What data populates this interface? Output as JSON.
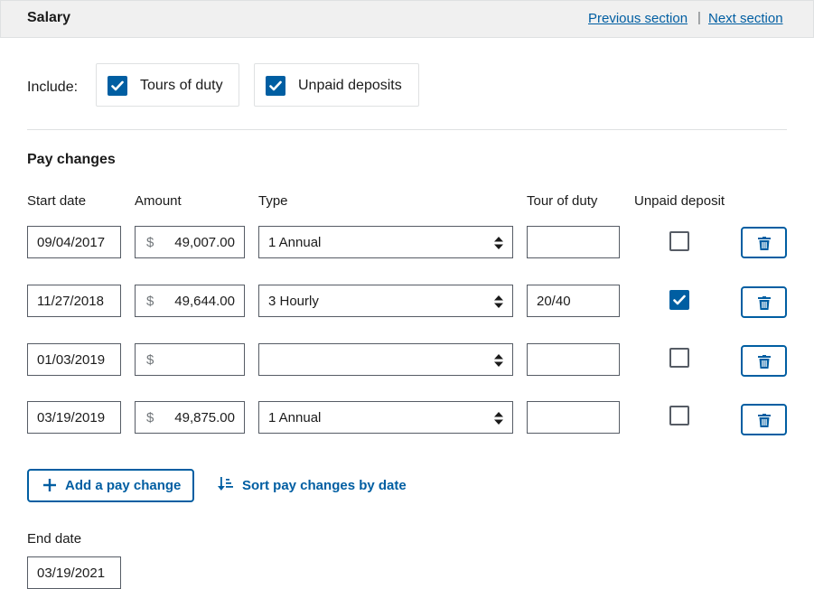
{
  "header": {
    "title": "Salary",
    "prev_link": "Previous section",
    "separator": "|",
    "next_link": "Next section"
  },
  "include": {
    "label": "Include:",
    "options": [
      {
        "label": "Tours of duty",
        "checked": true
      },
      {
        "label": "Unpaid deposits",
        "checked": true
      }
    ]
  },
  "pay_changes": {
    "title": "Pay changes",
    "columns": [
      "Start date",
      "Amount",
      "Type",
      "Tour of duty",
      "Unpaid deposit"
    ],
    "currency_symbol": "$",
    "rows": [
      {
        "start_date": "09/04/2017",
        "amount": "49,007.00",
        "type": "1  Annual",
        "tour": "",
        "unpaid": false
      },
      {
        "start_date": "11/27/2018",
        "amount": "49,644.00",
        "type": "3  Hourly",
        "tour": "20/40",
        "unpaid": true
      },
      {
        "start_date": "01/03/2019",
        "amount": "",
        "type": "",
        "tour": "",
        "unpaid": false
      },
      {
        "start_date": "03/19/2019",
        "amount": "49,875.00",
        "type": "1  Annual",
        "tour": "",
        "unpaid": false
      }
    ],
    "add_button": "Add a pay change",
    "sort_link": "Sort pay changes by date"
  },
  "end_date": {
    "label": "End date",
    "value": "03/19/2021"
  },
  "colors": {
    "primary": "#005ea2",
    "border": "#565c65",
    "header_bg": "#f0f0f0"
  },
  "icons": [
    "checkmark-icon",
    "sort-arrows-icon",
    "trash-icon",
    "plus-icon",
    "sort-descending-icon"
  ]
}
